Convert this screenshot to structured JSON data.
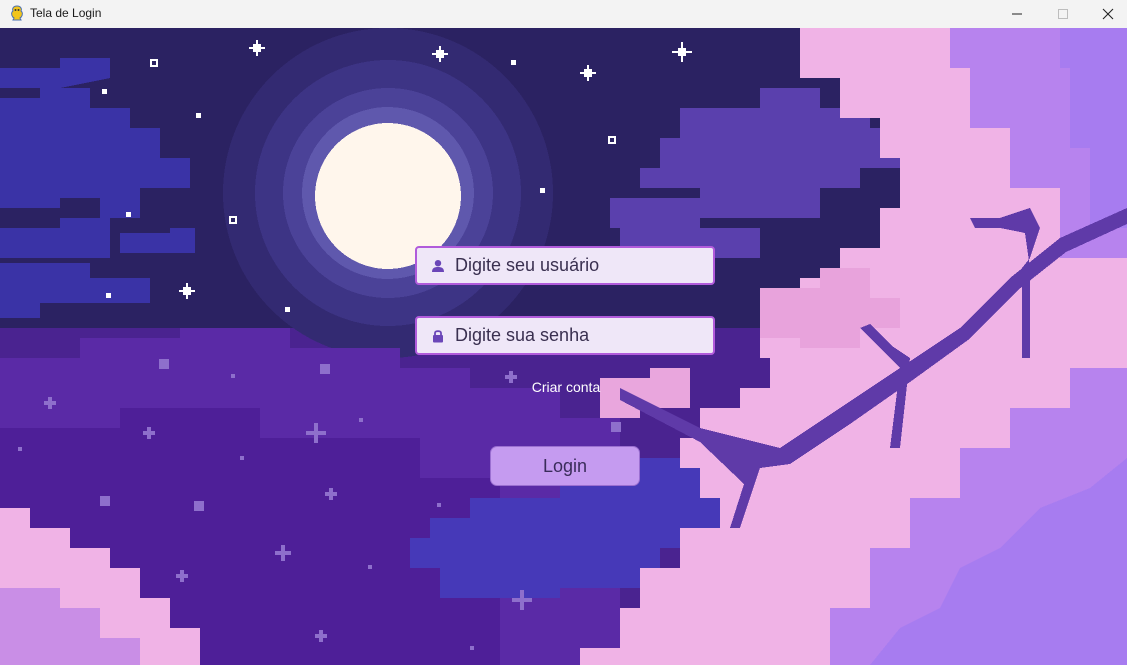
{
  "window": {
    "title": "Tela de Login",
    "icon": "pygame-snake-icon",
    "controls": [
      "minimize-icon",
      "maximize-icon",
      "close-icon"
    ]
  },
  "login": {
    "username_placeholder": "Digite seu usuário",
    "username_value": "",
    "password_placeholder": "Digite sua senha",
    "password_value": "",
    "create_account_label": "Criar conta",
    "login_button_label": "Login",
    "username_icon": "user-icon",
    "password_icon": "lock-icon"
  },
  "colors": {
    "field_bg": "#efe7f8",
    "field_border": "#b15bdb",
    "button_bg": "#c59bf0",
    "sky": "#2a2160",
    "moon": "#fff6ec"
  }
}
